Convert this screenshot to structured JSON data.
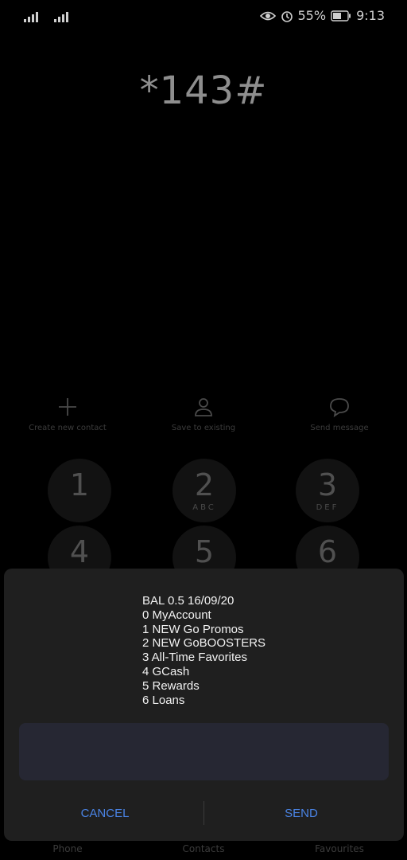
{
  "status_bar": {
    "battery_percent": "55%",
    "time": "9:13",
    "icons": [
      "signal-icon",
      "signal-icon",
      "eye-comfort-icon",
      "alarm-icon",
      "battery-icon"
    ]
  },
  "dialer": {
    "number": "*143#",
    "actions": [
      {
        "label": "Create new contact",
        "icon": "plus-icon"
      },
      {
        "label": "Save to existing",
        "icon": "person-icon"
      },
      {
        "label": "Send message",
        "icon": "message-icon"
      }
    ],
    "keys": [
      {
        "digit": "1",
        "letters": ""
      },
      {
        "digit": "2",
        "letters": "ABC"
      },
      {
        "digit": "3",
        "letters": "DEF"
      },
      {
        "digit": "4",
        "letters": ""
      },
      {
        "digit": "5",
        "letters": ""
      },
      {
        "digit": "6",
        "letters": ""
      }
    ]
  },
  "nav": {
    "items": [
      "Phone",
      "Contacts",
      "Favourites"
    ]
  },
  "ussd_dialog": {
    "message": "BAL 0.5 16/09/20\n0 MyAccount\n1 NEW Go Promos\n2 NEW GoBOOSTERS\n3 All-Time Favorites\n4 GCash\n5 Rewards\n6 Loans",
    "input_value": "",
    "cancel_label": "CANCEL",
    "send_label": "SEND",
    "accent_color": "#4a84e6"
  }
}
